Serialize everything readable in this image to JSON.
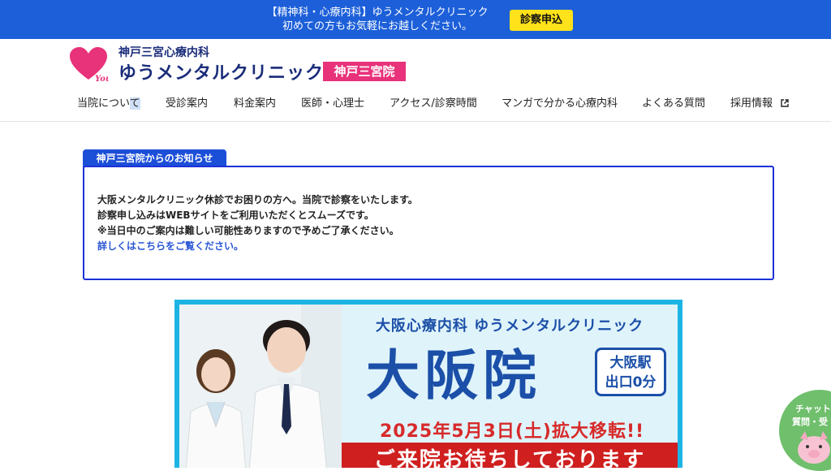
{
  "topbar": {
    "line1": "【精神科・心療内科】ゆうメンタルクリニック",
    "line2": "初めての方もお気軽にお越しください。",
    "cta_label": "診察申込"
  },
  "header": {
    "logo_sub": "神戸三宮心療内科",
    "logo_main": "ゆうメンタルクリニック",
    "logo_branch": "神戸三宮院",
    "logo_mark_text": "You"
  },
  "nav": {
    "items": [
      {
        "label_a": "当院につい",
        "label_b": "て"
      },
      {
        "label": "受診案内"
      },
      {
        "label": "料金案内"
      },
      {
        "label": "医師・心理士"
      },
      {
        "label": "アクセス/診察時間"
      },
      {
        "label": "マンガで分かる心療内科"
      },
      {
        "label": "よくある質問"
      },
      {
        "label": "採用情報"
      }
    ]
  },
  "notice": {
    "tab": "神戸三宮院からのお知らせ",
    "line1": "大阪メンタルクリニック休診でお困りの方へ。当院で診察をいたします。",
    "line2": "診察申し込みはWEBサイトをご利用いただくとスムーズです。",
    "line3": "※当日中のご案内は難しい可能性ありますので予めご了承ください。",
    "link": "詳しくはこちらをご覧ください。"
  },
  "banner": {
    "title": "大阪心療内科 ゆうメンタルクリニック",
    "big": "大阪院",
    "station_l1": "大阪駅",
    "station_l2": "出口0分",
    "date": "2025年5月3日(土)拡大移転!!",
    "red_text": "ご来院お待ちしております"
  },
  "chat": {
    "line1": "チャット",
    "line2": "質問・受"
  },
  "colors": {
    "topbar": "#1c5fd9",
    "cta": "#ffe21a",
    "brand_navy": "#1a2d7a",
    "brand_pink": "#e8327a",
    "notice_border": "#1c32d8",
    "banner_border": "#1db4e4",
    "banner_red": "#cf1f1f",
    "chat_green": "#6fbf6c"
  }
}
